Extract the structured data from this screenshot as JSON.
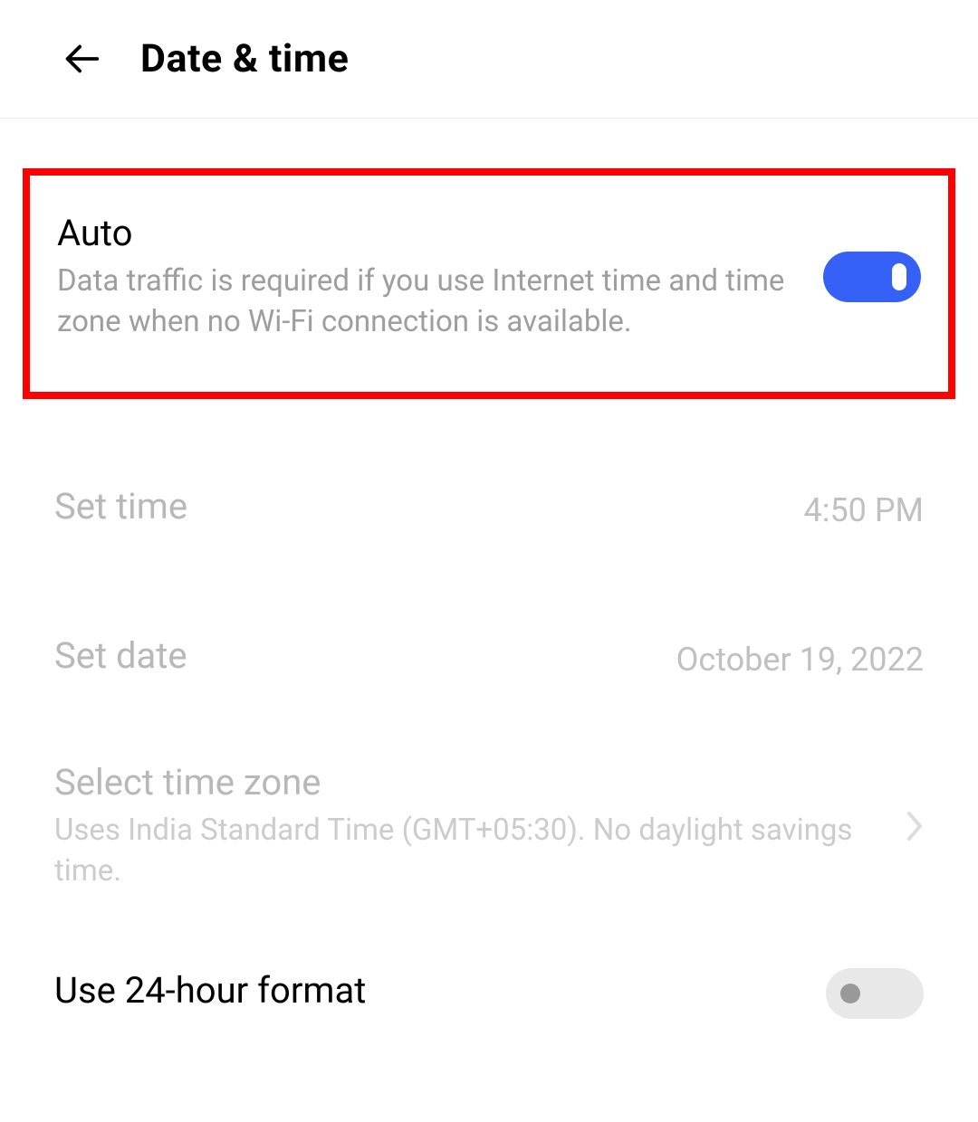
{
  "header": {
    "title": "Date & time"
  },
  "settings": {
    "auto": {
      "title": "Auto",
      "description": "Data traffic is required if you use Internet time and time zone when no Wi-Fi connection is available.",
      "enabled": true
    },
    "setTime": {
      "title": "Set time",
      "value": "4:50 PM"
    },
    "setDate": {
      "title": "Set date",
      "value": "October 19, 2022"
    },
    "timezone": {
      "title": "Select time zone",
      "description": "Uses India Standard Time (GMT+05:30). No daylight savings time."
    },
    "format24h": {
      "title": "Use 24-hour format",
      "enabled": false
    }
  }
}
